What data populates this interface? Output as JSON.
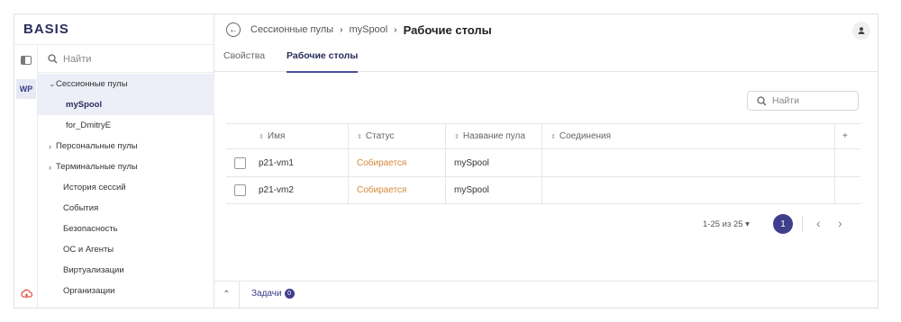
{
  "app": {
    "logo": "BASIS"
  },
  "sidebar": {
    "rail_badge": "WP",
    "search_placeholder": "Найти",
    "items": [
      {
        "label": "Сессионные пулы"
      },
      {
        "label": "mySpool"
      },
      {
        "label": "for_DmitryE"
      },
      {
        "label": "Персональные пулы"
      },
      {
        "label": "Терминальные пулы"
      },
      {
        "label": "История сессий"
      },
      {
        "label": "События"
      },
      {
        "label": "Безопасность"
      },
      {
        "label": "ОС и Агенты"
      },
      {
        "label": "Виртуализации"
      },
      {
        "label": "Организации"
      }
    ]
  },
  "header": {
    "breadcrumb": [
      "Сессионные пулы",
      "mySpool"
    ],
    "title": "Рабочие столы"
  },
  "tabs": [
    {
      "label": "Свойства"
    },
    {
      "label": "Рабочие столы"
    }
  ],
  "search": {
    "placeholder": "Найти"
  },
  "table": {
    "columns": [
      "Имя",
      "Статус",
      "Название пула",
      "Соединения"
    ],
    "rows": [
      {
        "name": "p21-vm1",
        "status": "Собирается",
        "pool": "mySpool",
        "connections": ""
      },
      {
        "name": "p21-vm2",
        "status": "Собирается",
        "pool": "mySpool",
        "connections": ""
      }
    ]
  },
  "pagination": {
    "range": "1-25 из 25",
    "current_page": "1"
  },
  "footer": {
    "tasks_label": "Задачи",
    "tasks_count": "0"
  },
  "colors": {
    "accent": "#3e3f8c",
    "status_building": "#d4893a",
    "nav_active_bg": "#eceef8"
  }
}
